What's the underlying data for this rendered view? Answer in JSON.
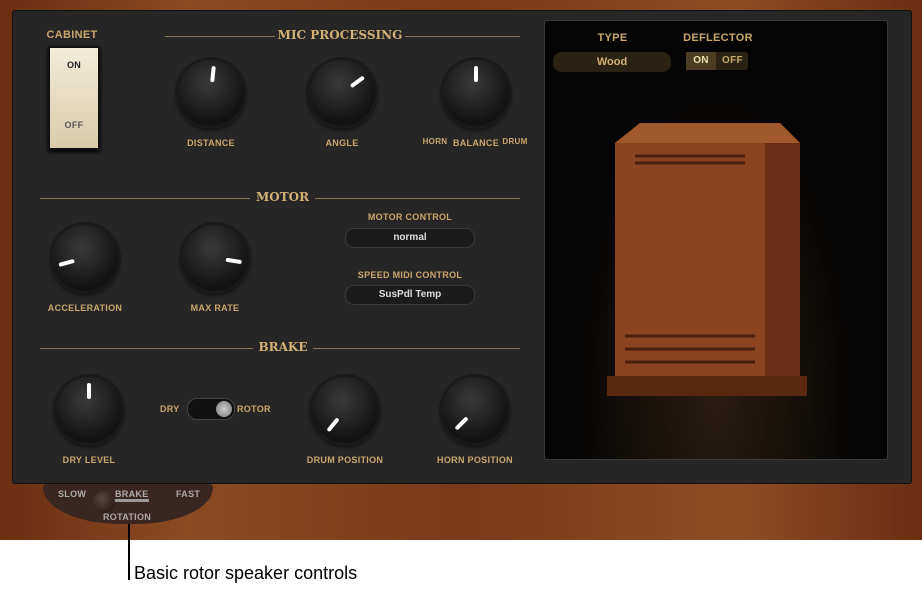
{
  "cabinet": {
    "label": "CABINET",
    "on": "ON",
    "off": "OFF",
    "state": "ON"
  },
  "sections": {
    "mic": "MIC PROCESSING",
    "motor": "MOTOR",
    "brake": "BRAKE"
  },
  "knobs": [
    {
      "id": "distance",
      "label": "DISTANCE",
      "value": 0.52
    },
    {
      "id": "angle",
      "label": "ANGLE",
      "value": 0.68
    },
    {
      "id": "balance",
      "label": "BALANCE",
      "value": 0.5,
      "min_label": "HORN",
      "max_label": "DRUM"
    },
    {
      "id": "acceleration",
      "label": "ACCELERATION",
      "value": 0.15
    },
    {
      "id": "max_rate",
      "label": "MAX RATE",
      "value": 0.83
    },
    {
      "id": "dry_level",
      "label": "DRY LEVEL",
      "value": 0.5
    },
    {
      "id": "drum_position",
      "label": "DRUM POSITION",
      "value": 0.03
    },
    {
      "id": "horn_position",
      "label": "HORN POSITION",
      "value": 0.05
    }
  ],
  "motor_control": {
    "label": "MOTOR CONTROL",
    "value": "normal"
  },
  "speed_midi": {
    "label": "SPEED MIDI CONTROL",
    "value": "SusPdl Temp"
  },
  "dry_rotor": {
    "dry": "DRY",
    "rotor": "ROTOR",
    "state": "ROTOR"
  },
  "type": {
    "label": "TYPE",
    "value": "Wood"
  },
  "deflector": {
    "label": "DEFLECTOR",
    "on": "ON",
    "off": "OFF",
    "state": "ON"
  },
  "rotation": {
    "slow": "SLOW",
    "brake": "BRAKE",
    "fast": "FAST",
    "label": "ROTATION",
    "state": "BRAKE"
  },
  "caption": "Basic rotor speaker controls",
  "colors": {
    "accent": "#c9a66b",
    "panel": "#262626",
    "wood": "#7a3a18"
  }
}
